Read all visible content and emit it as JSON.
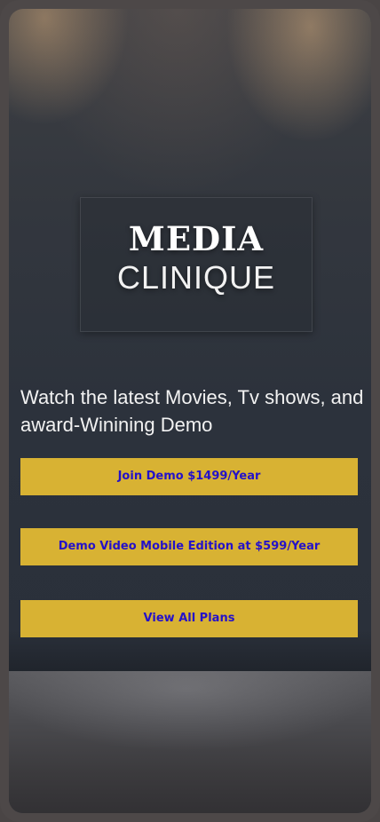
{
  "hero": {
    "logo_top": "MEDIA",
    "logo_bottom": "CLINIQUE",
    "tagline": "Watch the latest Movies, Tv shows, and award-Winining Demo"
  },
  "actions": {
    "join_demo": "Join Demo $1499/Year",
    "mobile_edition": "Demo Video Mobile Edition at $599/Year",
    "view_plans": "View All Plans"
  },
  "colors": {
    "button_bg": "#d8b233",
    "button_text": "#2411c9",
    "wall": "#2c323c",
    "frame": "#4d4848"
  }
}
